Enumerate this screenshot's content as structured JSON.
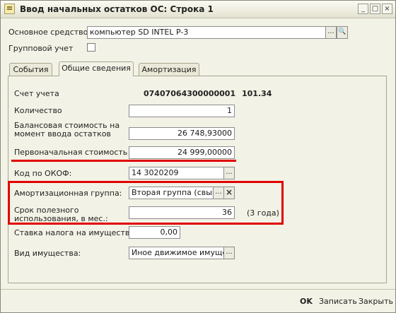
{
  "window": {
    "title": "Ввод начальных остатков ОС: Строка 1",
    "controls": [
      "_",
      "□",
      "×"
    ]
  },
  "top": {
    "asset_label": "Основное средство",
    "asset_value": "компьютер SD INTEL P-3",
    "group_label": "Групповой учет",
    "group_checked": false
  },
  "tabs": [
    {
      "label": "События",
      "active": false
    },
    {
      "label": "Общие сведения",
      "active": true
    },
    {
      "label": "Амортизация",
      "active": false
    }
  ],
  "form": {
    "account_label": "Счет учета",
    "account_value": "07407064300000001",
    "account_code": "101.34",
    "qty_label": "Количество",
    "qty_value": "1",
    "balance_label_1": "Балансовая стоимость на",
    "balance_label_2": "момент ввода остатков",
    "balance_value": "26 748,93000",
    "initial_label": "Первоначальная стоимость",
    "initial_value": "24 999,00000",
    "okof_label": "Код по ОКОФ:",
    "okof_value": "14 3020209",
    "amort_label": "Амортизационная группа:",
    "amort_value": "Вторая группа (свыше",
    "life_label_1": "Срок полезного",
    "life_label_2": "использования, в мес.:",
    "life_value": "36",
    "life_note": "(3 года)",
    "tax_label": "Ставка налога на имущество",
    "tax_value": "0,00",
    "property_label": "Вид имущества:",
    "property_value": "Иное движимое имущест"
  },
  "buttons": {
    "ellipsis": "...",
    "search": "🔍",
    "clear": "×",
    "ok": "OK",
    "save": "Записать",
    "close": "Закрыть"
  },
  "colors": {
    "highlight": "#e00000"
  }
}
